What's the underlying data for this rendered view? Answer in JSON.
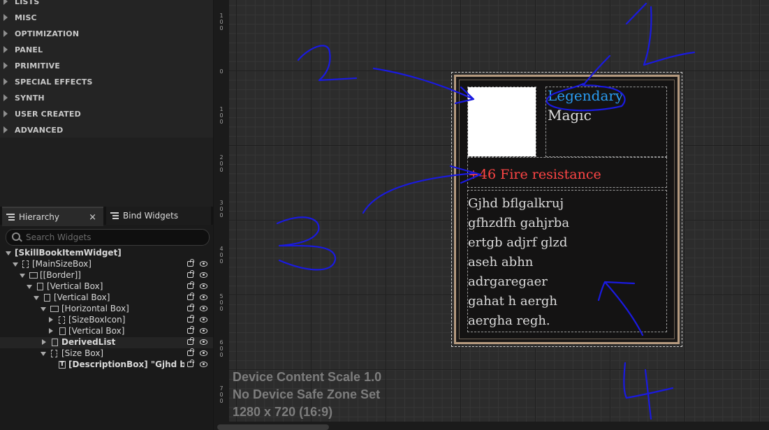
{
  "palette": {
    "categories": [
      "LISTS",
      "MISC",
      "OPTIMIZATION",
      "PANEL",
      "PRIMITIVE",
      "SPECIAL EFFECTS",
      "SYNTH",
      "USER CREATED",
      "ADVANCED"
    ]
  },
  "panel_tabs": {
    "hierarchy_label": "Hierarchy",
    "close_glyph": "×",
    "bind_widgets_label": "Bind Widgets"
  },
  "search": {
    "placeholder": "Search Widgets"
  },
  "tree": {
    "root": "[SkillBookItemWidget]",
    "main_size_box": "[MainSizeBox]",
    "border": "[[Border]]",
    "vertical_box_1": "[Vertical Box]",
    "vertical_box_2": "[Vertical Box]",
    "horizontal_box": "[Horizontal Box]",
    "size_box_icon": "[SizeBoxIcon]",
    "vertical_box_3": "[Vertical Box]",
    "derived_list": "DerivedList",
    "size_box": "[Size Box]",
    "description_box": "[DescriptionBox] \"Gjhd bflgal",
    "text_icon_glyph": "T"
  },
  "ruler": {
    "labels": [
      "1 0 0",
      "0",
      "1 0 0",
      "2 0 0",
      "3 0 0",
      "4 0 0",
      "5 0 0",
      "6 0 0",
      "7 0 0"
    ]
  },
  "item": {
    "rarity": "Legendary",
    "type": "Magic",
    "stat": "+46 Fire resistance",
    "description_lines": [
      "Gjhd bflgalkruj",
      "gfhzdfh gahjrba",
      "ertgb adjrf glzd",
      "aseh abhn",
      "adrgaregaer",
      "gahat h aergh",
      "aergha regh."
    ]
  },
  "viewport_info": {
    "scale": "Device Content Scale 1.0",
    "safe_zone": "No Device Safe Zone Set",
    "resolution": "1280 x 720 (16:9)"
  },
  "colors": {
    "rarity_blue": "#2a9cf2",
    "stat_red": "#ff4545",
    "frame_tan": "#b59a7f",
    "annotation_blue": "#1a1ae0"
  }
}
